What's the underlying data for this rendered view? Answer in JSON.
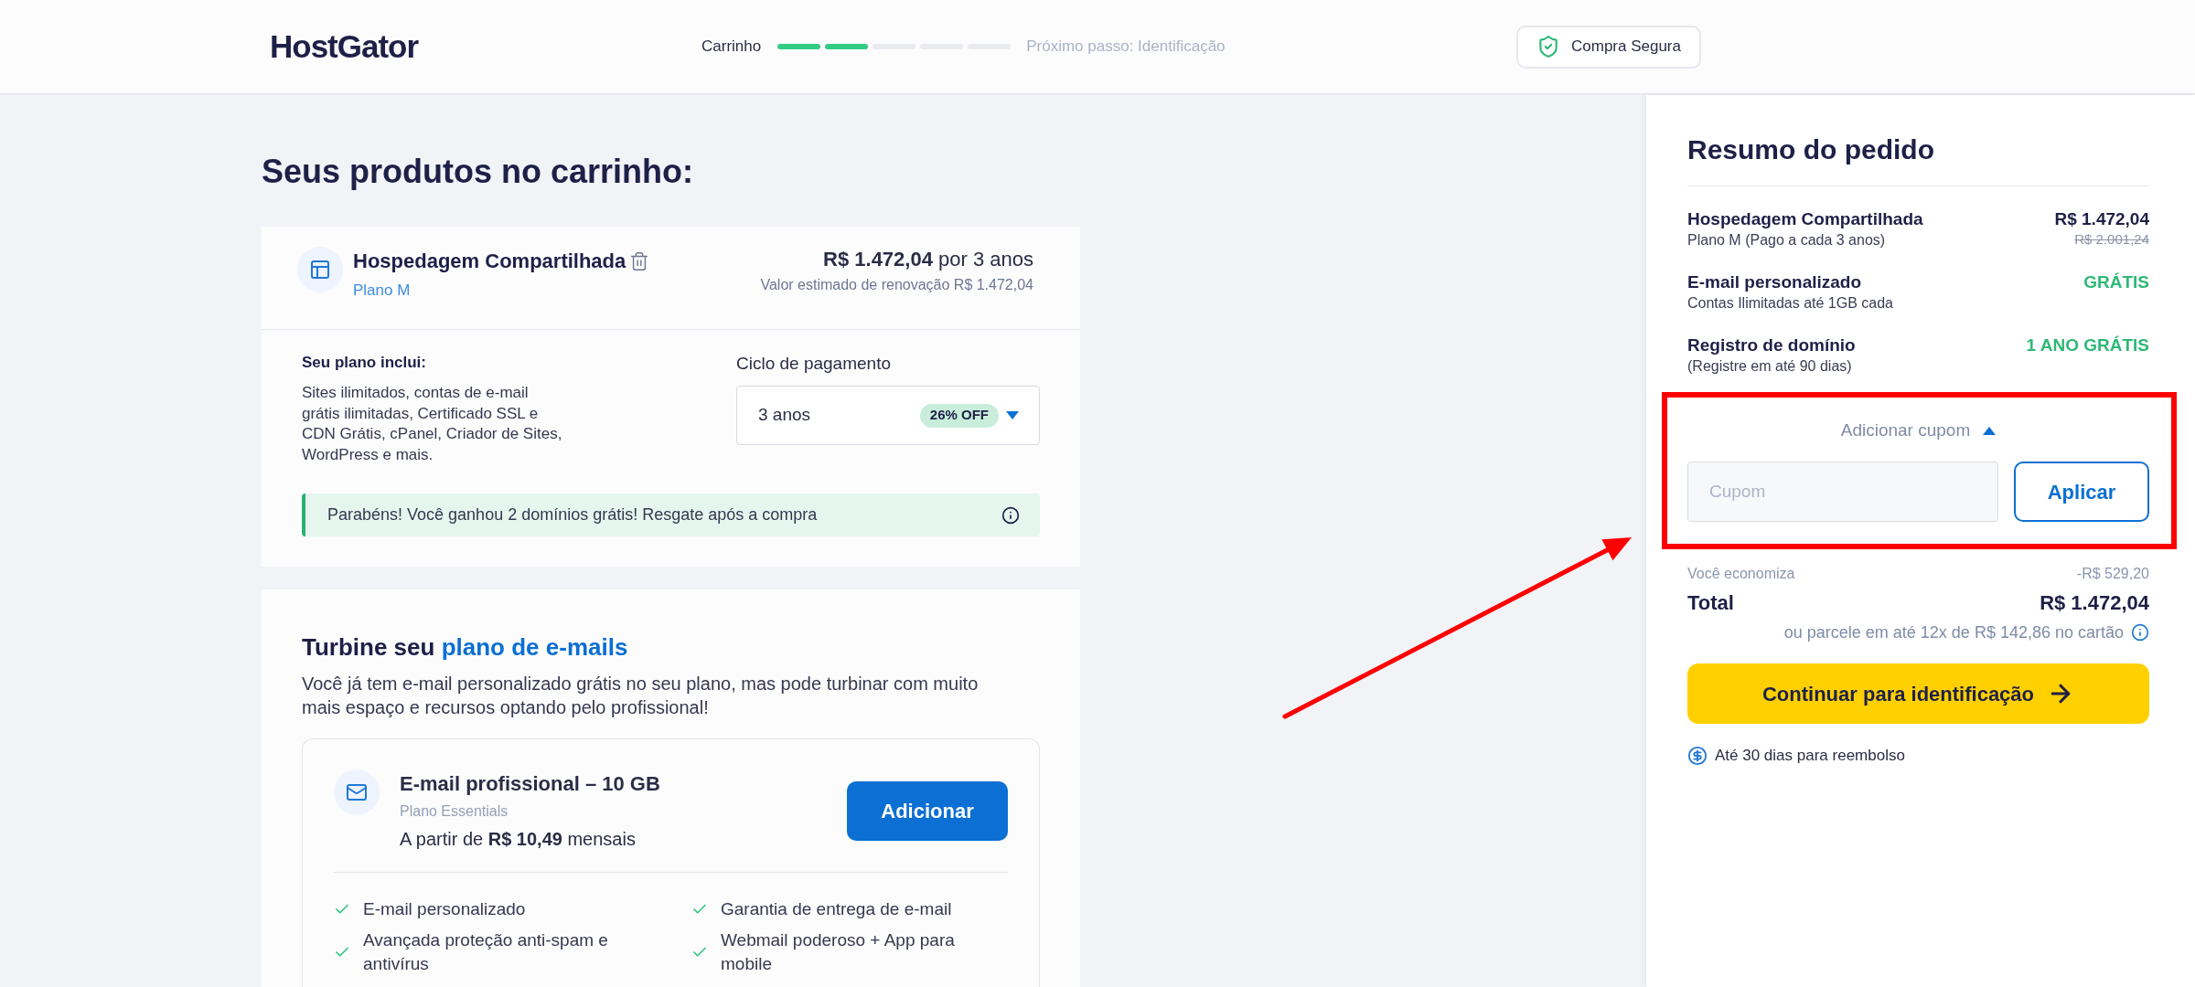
{
  "header": {
    "logo": "HostGator",
    "progress": {
      "label": "Carrinho",
      "steps": [
        {
          "done": true
        },
        {
          "done": true
        },
        {
          "done": false
        },
        {
          "done": false
        },
        {
          "done": false
        }
      ],
      "next": "Próximo passo: Identificação"
    },
    "badge": "Compra Segura"
  },
  "cart": {
    "title": "Seus produtos no carrinho:",
    "product": {
      "name": "Hospedagem Compartilhada",
      "plan": "Plano M",
      "price": "**R$ 1.472,04** por 3 anos",
      "renewal": "Valor estimado de renovação R$ 1.472,04",
      "includes_title": "Seu plano inclui:",
      "includes_text": "Sites ilimitados, contas de e-mail grátis ilimitadas, Certificado SSL e CDN Grátis, cPanel, Criador de Sites, WordPress e mais.",
      "cycle": {
        "label": "Ciclo de pagamento",
        "value": "3 anos",
        "badge": "26% OFF"
      },
      "notice": "Parabéns! Você ganhou 2 domínios grátis! Resgate após a compra"
    }
  },
  "upsell": {
    "title": "Turbine seu",
    "title_highlight": "plano de e-mails",
    "description": "Você já tem e-mail personalizado grátis no seu plano, mas pode turbinar com muito mais espaço e recursos optando pelo profissional!",
    "offer": {
      "name": "E-mail profissional – 10 GB",
      "plan": "Plano Essentials",
      "price": "A partir de **R$ 10,49** mensais",
      "button": "Adicionar",
      "features": [
        "E-mail personalizado",
        "Garantia de entrega de e-mail",
        "Avançada proteção anti-spam e antivírus",
        "Webmail poderoso + App para mobile"
      ]
    }
  },
  "summary": {
    "title": "Resumo do pedido",
    "items": [
      {
        "kind": "price",
        "name": "Hospedagem Compartilhada",
        "detail": "Plano M (Pago a cada 3 anos)",
        "value": "R$ 1.472,04",
        "old_value": "R$ 2.001,24"
      },
      {
        "kind": "free",
        "name": "E-mail personalizado",
        "detail": "Contas Ilimitadas até 1GB cada",
        "value": "GRÁTIS"
      },
      {
        "kind": "free",
        "name": "Registro de domínio",
        "detail": "(Registre em até 90 dias)",
        "value": "1 ANO GRÁTIS"
      }
    ],
    "coupon": {
      "toggle": "Adicionar cupom",
      "expanded": true,
      "placeholder": "Cupom",
      "button": "Aplicar",
      "highlighted": true,
      "pointed_at": true
    },
    "savings": {
      "label": "Você economiza",
      "value": "-R$ 529,20"
    },
    "total": {
      "label": "Total",
      "value": "R$ 1.472,04"
    },
    "installments": "ou parcele em até 12x de R$ 142,86 no cartão",
    "continue_button": "Continuar para identificação",
    "refund": "Até 30 dias para reembolso"
  }
}
